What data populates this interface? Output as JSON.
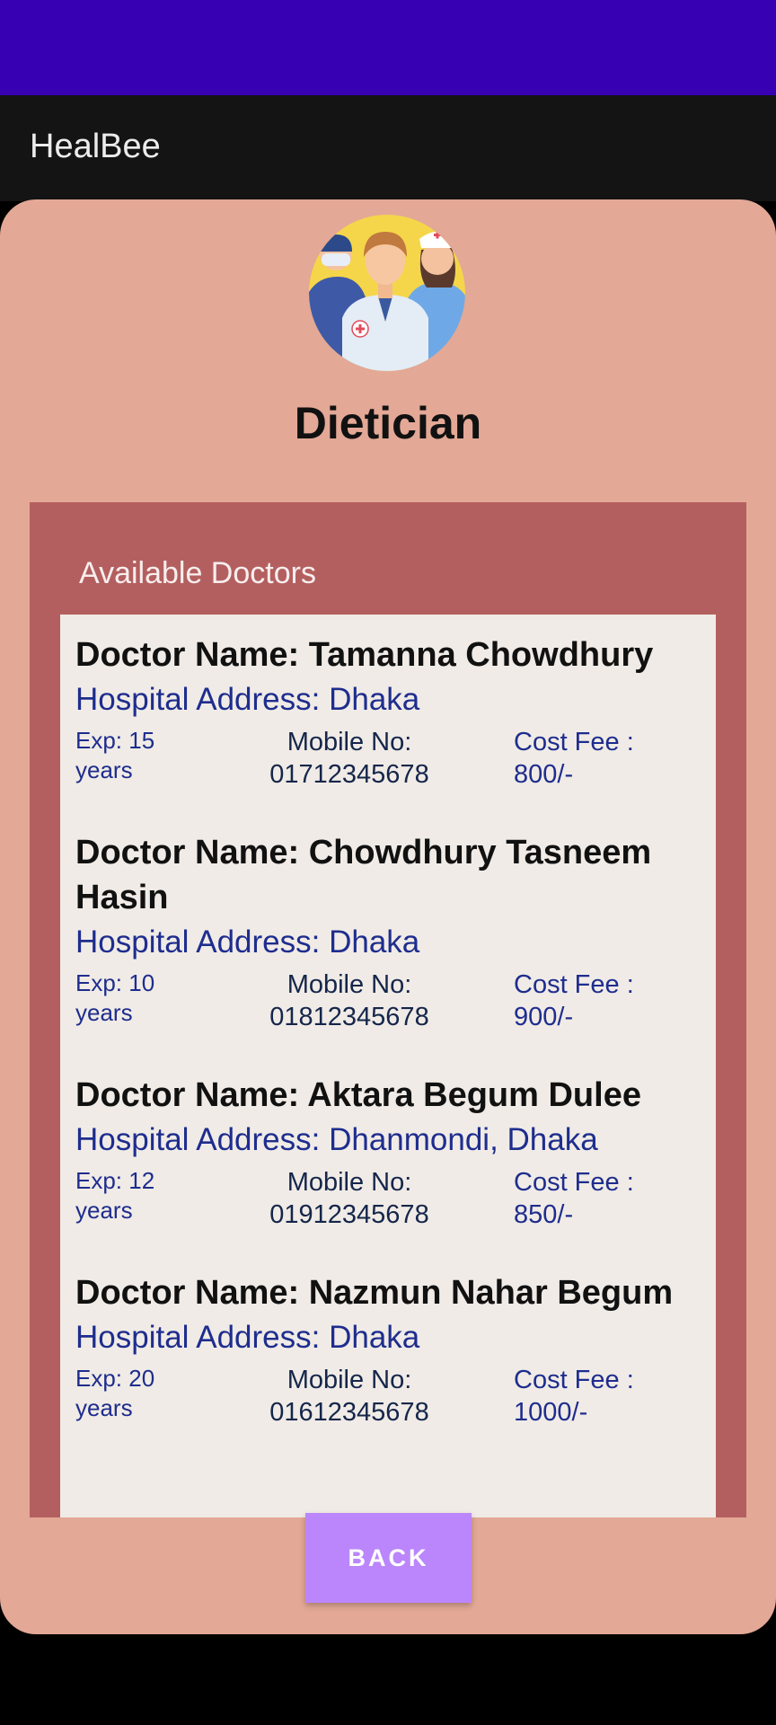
{
  "app": {
    "title": "HealBee"
  },
  "specialty": {
    "title": "Dietician",
    "icon": "doctors-team-icon"
  },
  "panel": {
    "title": "Available Doctors"
  },
  "doctors": [
    {
      "name": "Doctor Name: Tamanna Chowdhury",
      "address": "Hospital Address: Dhaka",
      "exp": "Exp: 15 years",
      "mobile_label": "Mobile No:",
      "mobile": "01712345678",
      "cost_label": "Cost Fee :",
      "cost": "800/-"
    },
    {
      "name": "Doctor Name: Chowdhury Tasneem Hasin",
      "address": "Hospital Address: Dhaka",
      "exp": "Exp: 10 years",
      "mobile_label": "Mobile No:",
      "mobile": "01812345678",
      "cost_label": "Cost Fee :",
      "cost": "900/-"
    },
    {
      "name": "Doctor Name: Aktara Begum Dulee",
      "address": "Hospital Address: Dhanmondi, Dhaka",
      "exp": "Exp: 12 years",
      "mobile_label": "Mobile No:",
      "mobile": "01912345678",
      "cost_label": "Cost Fee :",
      "cost": "850/-"
    },
    {
      "name": "Doctor Name: Nazmun Nahar Begum",
      "address": "Hospital Address: Dhaka",
      "exp": "Exp: 20 years",
      "mobile_label": "Mobile No:",
      "mobile": "01612345678",
      "cost_label": "Cost Fee :",
      "cost": "1000/-"
    }
  ],
  "buttons": {
    "back_label": "BACK"
  },
  "colors": {
    "status_bar": "#3700b3",
    "app_bar": "#141414",
    "card": "#e3a896",
    "panel": "#b45f5f",
    "list": "#f0ebe6",
    "accent": "#bb86fc",
    "address_text": "#1e2d8e"
  }
}
